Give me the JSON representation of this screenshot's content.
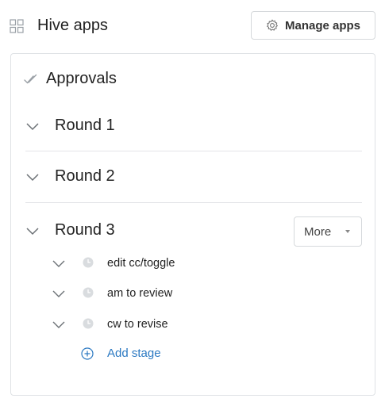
{
  "header": {
    "title": "Hive apps",
    "manage_button_label": "Manage apps",
    "apps_icon": "grid-icon",
    "manage_icon": "gear-icon"
  },
  "panel": {
    "title": "Approvals",
    "title_icon": "double-check-icon",
    "rounds": [
      {
        "label": "Round 1"
      },
      {
        "label": "Round 2"
      },
      {
        "label": "Round 3"
      }
    ],
    "more_button_label": "More",
    "stages": [
      {
        "label": "edit cc/toggle",
        "icon": "clock-icon"
      },
      {
        "label": "am to review",
        "icon": "clock-icon"
      },
      {
        "label": "cw to revise",
        "icon": "clock-icon"
      }
    ],
    "add_stage_label": "Add stage"
  },
  "colors": {
    "accent": "#2b79c2",
    "border": "#dfe2e5",
    "muted_icon": "#d0d4d8",
    "chevron": "#6b7075"
  }
}
